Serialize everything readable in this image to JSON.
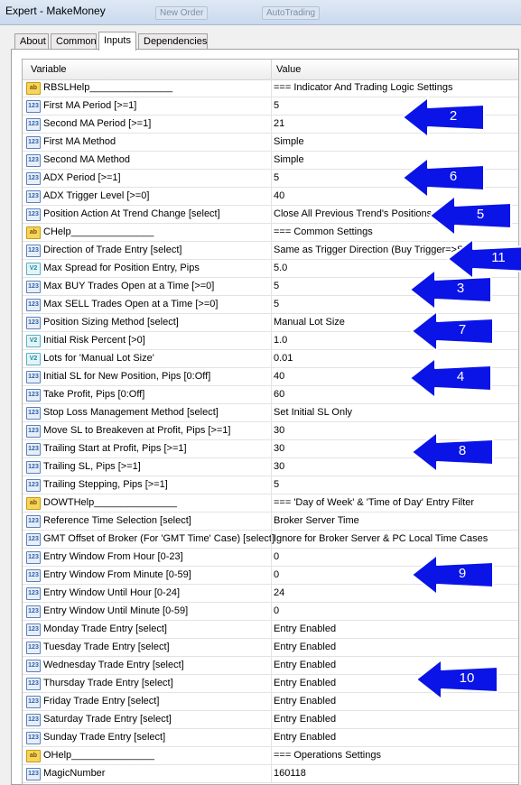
{
  "window": {
    "title": "Expert - MakeMoney",
    "bg_buttons": [
      "New Order",
      "AutoTrading"
    ]
  },
  "tabs": [
    {
      "label": "About"
    },
    {
      "label": "Common"
    },
    {
      "label": "Inputs",
      "active": true
    },
    {
      "label": "Dependencies"
    }
  ],
  "table": {
    "header": {
      "variable": "Variable",
      "value": "Value"
    },
    "rows": [
      {
        "icon": "string-icon",
        "name": "RBSLHelp_______________",
        "value": "=== Indicator And Trading Logic Settings"
      },
      {
        "icon": "integer-icon",
        "name": "First MA Period [>=1]",
        "value": "5"
      },
      {
        "icon": "integer-icon",
        "name": "Second MA Period [>=1]",
        "value": "21"
      },
      {
        "icon": "integer-icon",
        "name": "First MA Method",
        "value": "Simple"
      },
      {
        "icon": "integer-icon",
        "name": "Second MA Method",
        "value": "Simple"
      },
      {
        "icon": "integer-icon",
        "name": "ADX Period [>=1]",
        "value": "5"
      },
      {
        "icon": "integer-icon",
        "name": "ADX Trigger Level [>=0]",
        "value": "40"
      },
      {
        "icon": "integer-icon",
        "name": "Position Action At Trend Change [select]",
        "value": "Close All Previous Trend's Positions"
      },
      {
        "icon": "string-icon",
        "name": "CHelp_______________",
        "value": "=== Common Settings"
      },
      {
        "icon": "integer-icon",
        "name": "Direction of Trade Entry [select]",
        "value": "Same as Trigger Direction (Buy Trigger=>S"
      },
      {
        "icon": "double-icon",
        "name": "Max Spread for Position Entry, Pips",
        "value": "5.0"
      },
      {
        "icon": "integer-icon",
        "name": "Max BUY Trades Open at a Time [>=0]",
        "value": "5"
      },
      {
        "icon": "integer-icon",
        "name": "Max SELL Trades Open at a Time [>=0]",
        "value": "5"
      },
      {
        "icon": "integer-icon",
        "name": "Position Sizing Method [select]",
        "value": "Manual Lot Size"
      },
      {
        "icon": "double-icon",
        "name": "Initial Risk Percent [>0]",
        "value": "1.0"
      },
      {
        "icon": "double-icon",
        "name": "Lots for 'Manual Lot Size'",
        "value": "0.01"
      },
      {
        "icon": "integer-icon",
        "name": "Initial SL for New Position, Pips [0:Off]",
        "value": "40"
      },
      {
        "icon": "integer-icon",
        "name": "Take Profit, Pips [0:Off]",
        "value": "60"
      },
      {
        "icon": "integer-icon",
        "name": "Stop Loss Management Method [select]",
        "value": "Set Initial SL Only"
      },
      {
        "icon": "integer-icon",
        "name": "Move SL to Breakeven at Profit, Pips [>=1]",
        "value": "30"
      },
      {
        "icon": "integer-icon",
        "name": "Trailing Start at Profit, Pips [>=1]",
        "value": "30"
      },
      {
        "icon": "integer-icon",
        "name": "Trailing SL, Pips [>=1]",
        "value": "30"
      },
      {
        "icon": "integer-icon",
        "name": "Trailing Stepping, Pips [>=1]",
        "value": "5"
      },
      {
        "icon": "string-icon",
        "name": "DOWTHelp_______________",
        "value": "=== 'Day of Week' & 'Time of Day' Entry Filter"
      },
      {
        "icon": "integer-icon",
        "name": "Reference Time Selection [select]",
        "value": "Broker Server Time"
      },
      {
        "icon": "integer-icon",
        "name": "GMT Offset of Broker (For 'GMT Time' Case) [select]",
        "value": "Ignore for Broker Server & PC Local Time Cases"
      },
      {
        "icon": "integer-icon",
        "name": "Entry Window From Hour [0-23]",
        "value": "0"
      },
      {
        "icon": "integer-icon",
        "name": "Entry Window From Minute [0-59]",
        "value": "0"
      },
      {
        "icon": "integer-icon",
        "name": "Entry Window Until Hour [0-24]",
        "value": "24"
      },
      {
        "icon": "integer-icon",
        "name": "Entry Window Until Minute [0-59]",
        "value": "0"
      },
      {
        "icon": "integer-icon",
        "name": "Monday Trade Entry [select]",
        "value": "Entry Enabled"
      },
      {
        "icon": "integer-icon",
        "name": "Tuesday Trade Entry [select]",
        "value": "Entry Enabled"
      },
      {
        "icon": "integer-icon",
        "name": "Wednesday Trade Entry [select]",
        "value": "Entry Enabled"
      },
      {
        "icon": "integer-icon",
        "name": "Thursday Trade Entry [select]",
        "value": "Entry Enabled"
      },
      {
        "icon": "integer-icon",
        "name": "Friday Trade Entry [select]",
        "value": "Entry Enabled"
      },
      {
        "icon": "integer-icon",
        "name": "Saturday Trade Entry [select]",
        "value": "Entry Enabled"
      },
      {
        "icon": "integer-icon",
        "name": "Sunday Trade Entry [select]",
        "value": "Entry Enabled"
      },
      {
        "icon": "string-icon",
        "name": "OHelp_______________",
        "value": "=== Operations Settings"
      },
      {
        "icon": "integer-icon",
        "name": "MagicNumber",
        "value": "160118"
      }
    ]
  },
  "icon_labels": {
    "integer": "123",
    "string": "ab",
    "double": "V2"
  },
  "annotations": [
    {
      "label": "2"
    },
    {
      "label": "6"
    },
    {
      "label": "5"
    },
    {
      "label": "11"
    },
    {
      "label": "3"
    },
    {
      "label": "7"
    },
    {
      "label": "4"
    },
    {
      "label": "8"
    },
    {
      "label": "9"
    },
    {
      "label": "10"
    }
  ],
  "colors": {
    "arrow_fill": "#0a14e6",
    "arrow_stroke": "#ffffff"
  }
}
